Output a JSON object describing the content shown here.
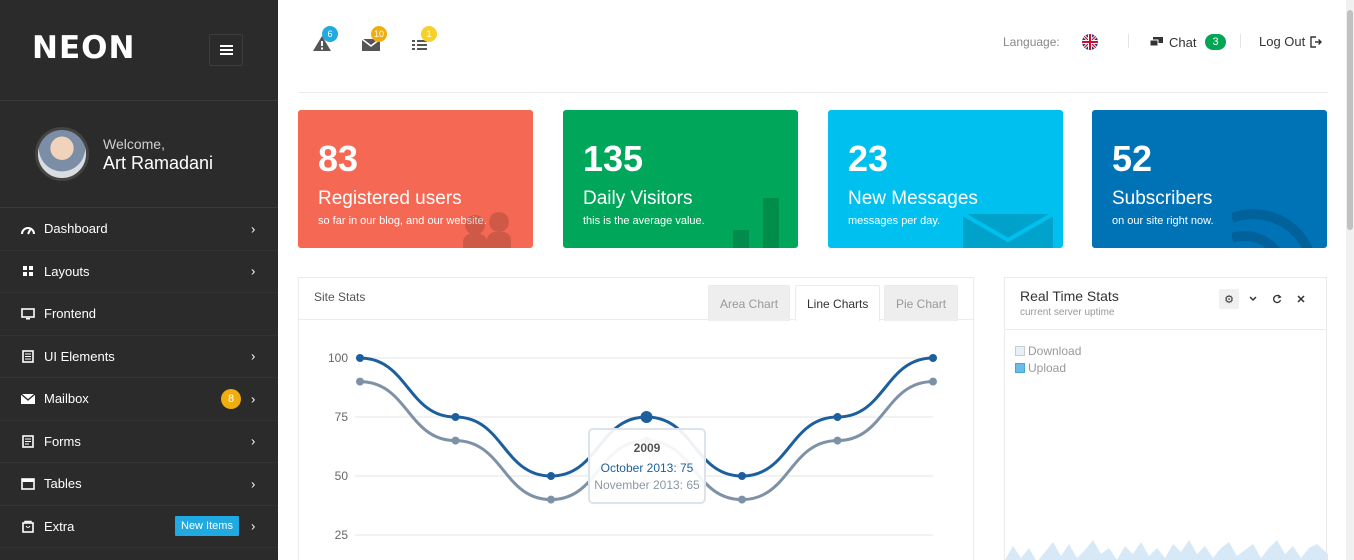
{
  "brand": {
    "logo": "NEON"
  },
  "user": {
    "welcome": "Welcome,",
    "name": "Art Ramadani"
  },
  "nav": [
    {
      "label": "Dashboard",
      "icon": "gauge-icon"
    },
    {
      "label": "Layouts",
      "icon": "grid-icon"
    },
    {
      "label": "Frontend",
      "icon": "monitor-icon"
    },
    {
      "label": "UI Elements",
      "icon": "document-icon"
    },
    {
      "label": "Mailbox",
      "icon": "mail-icon",
      "badge": "8"
    },
    {
      "label": "Forms",
      "icon": "form-icon"
    },
    {
      "label": "Tables",
      "icon": "window-icon"
    },
    {
      "label": "Extra",
      "icon": "bag-icon",
      "badge": "New Items"
    }
  ],
  "topbar": {
    "alerts_badge": "6",
    "messages_badge": "10",
    "tasks_badge": "1",
    "language_label": "Language:",
    "chat_label": "Chat",
    "chat_badge": "3",
    "logout_label": "Log Out"
  },
  "tiles": [
    {
      "value": "83",
      "title": "Registered users",
      "subtitle": "so far in our blog, and our website.",
      "color": "#f56954"
    },
    {
      "value": "135",
      "title": "Daily Visitors",
      "subtitle": "this is the average value.",
      "color": "#00a65a"
    },
    {
      "value": "23",
      "title": "New Messages",
      "subtitle": "messages per day.",
      "color": "#00c0ef"
    },
    {
      "value": "52",
      "title": "Subscribers",
      "subtitle": "on our site right now.",
      "color": "#0073b7"
    }
  ],
  "site_stats": {
    "title": "Site Stats",
    "tabs": [
      "Area Chart",
      "Line Charts",
      "Pie Chart"
    ],
    "active_tab": "Line Charts",
    "tooltip": {
      "title": "2009",
      "line1": "October 2013: 75",
      "line2": "November 2013: 65"
    }
  },
  "chart_data": {
    "type": "line",
    "x": [
      0,
      1,
      2,
      3,
      4,
      5,
      6
    ],
    "yticks": [
      100,
      75,
      50,
      25
    ],
    "ylim": [
      25,
      100
    ],
    "grid": true,
    "series": [
      {
        "values": [
          100,
          75,
          50,
          75,
          50,
          75,
          100
        ],
        "color": "#1d5f9d"
      },
      {
        "values": [
          90,
          65,
          40,
          65,
          40,
          65,
          90
        ],
        "color": "#7f91a6"
      }
    ]
  },
  "realtime": {
    "title": "Real Time Stats",
    "subtitle": "current server uptime",
    "legend": [
      {
        "label": "Download",
        "color": "#e8f0f7"
      },
      {
        "label": "Upload",
        "color": "#6bbbe9"
      }
    ]
  }
}
